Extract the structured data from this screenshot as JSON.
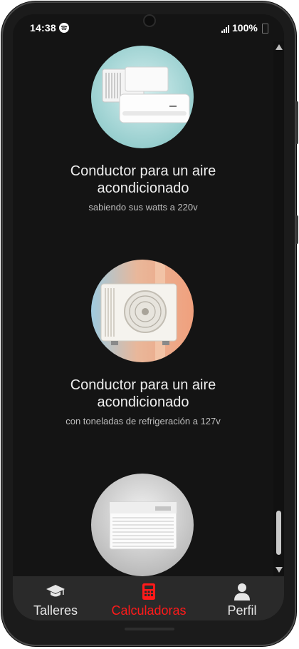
{
  "status_bar": {
    "time": "14:38",
    "battery": "100%",
    "icons": [
      "spotify-icon",
      "signal-icon",
      "battery-icon"
    ]
  },
  "cards": [
    {
      "title": "Conductor para un aire acondicionado",
      "subtitle": "sabiendo sus watts a 220v",
      "image": "split-ac-unit-image"
    },
    {
      "title": "Conductor para un aire acondicionado",
      "subtitle": "con toneladas de refrigeración a 127v",
      "image": "outdoor-condenser-image"
    },
    {
      "title": "",
      "subtitle": "",
      "image": "window-ac-unit-image"
    }
  ],
  "bottom_nav": {
    "items": [
      {
        "label": "Talleres",
        "icon": "graduation-cap-icon",
        "active": false
      },
      {
        "label": "Calculadoras",
        "icon": "calculator-icon",
        "active": true
      },
      {
        "label": "Perfil",
        "icon": "user-icon",
        "active": false
      }
    ]
  },
  "colors": {
    "background": "#141414",
    "nav_background": "#2a2a2a",
    "active": "#ff1a1a",
    "text": "#ededed"
  }
}
